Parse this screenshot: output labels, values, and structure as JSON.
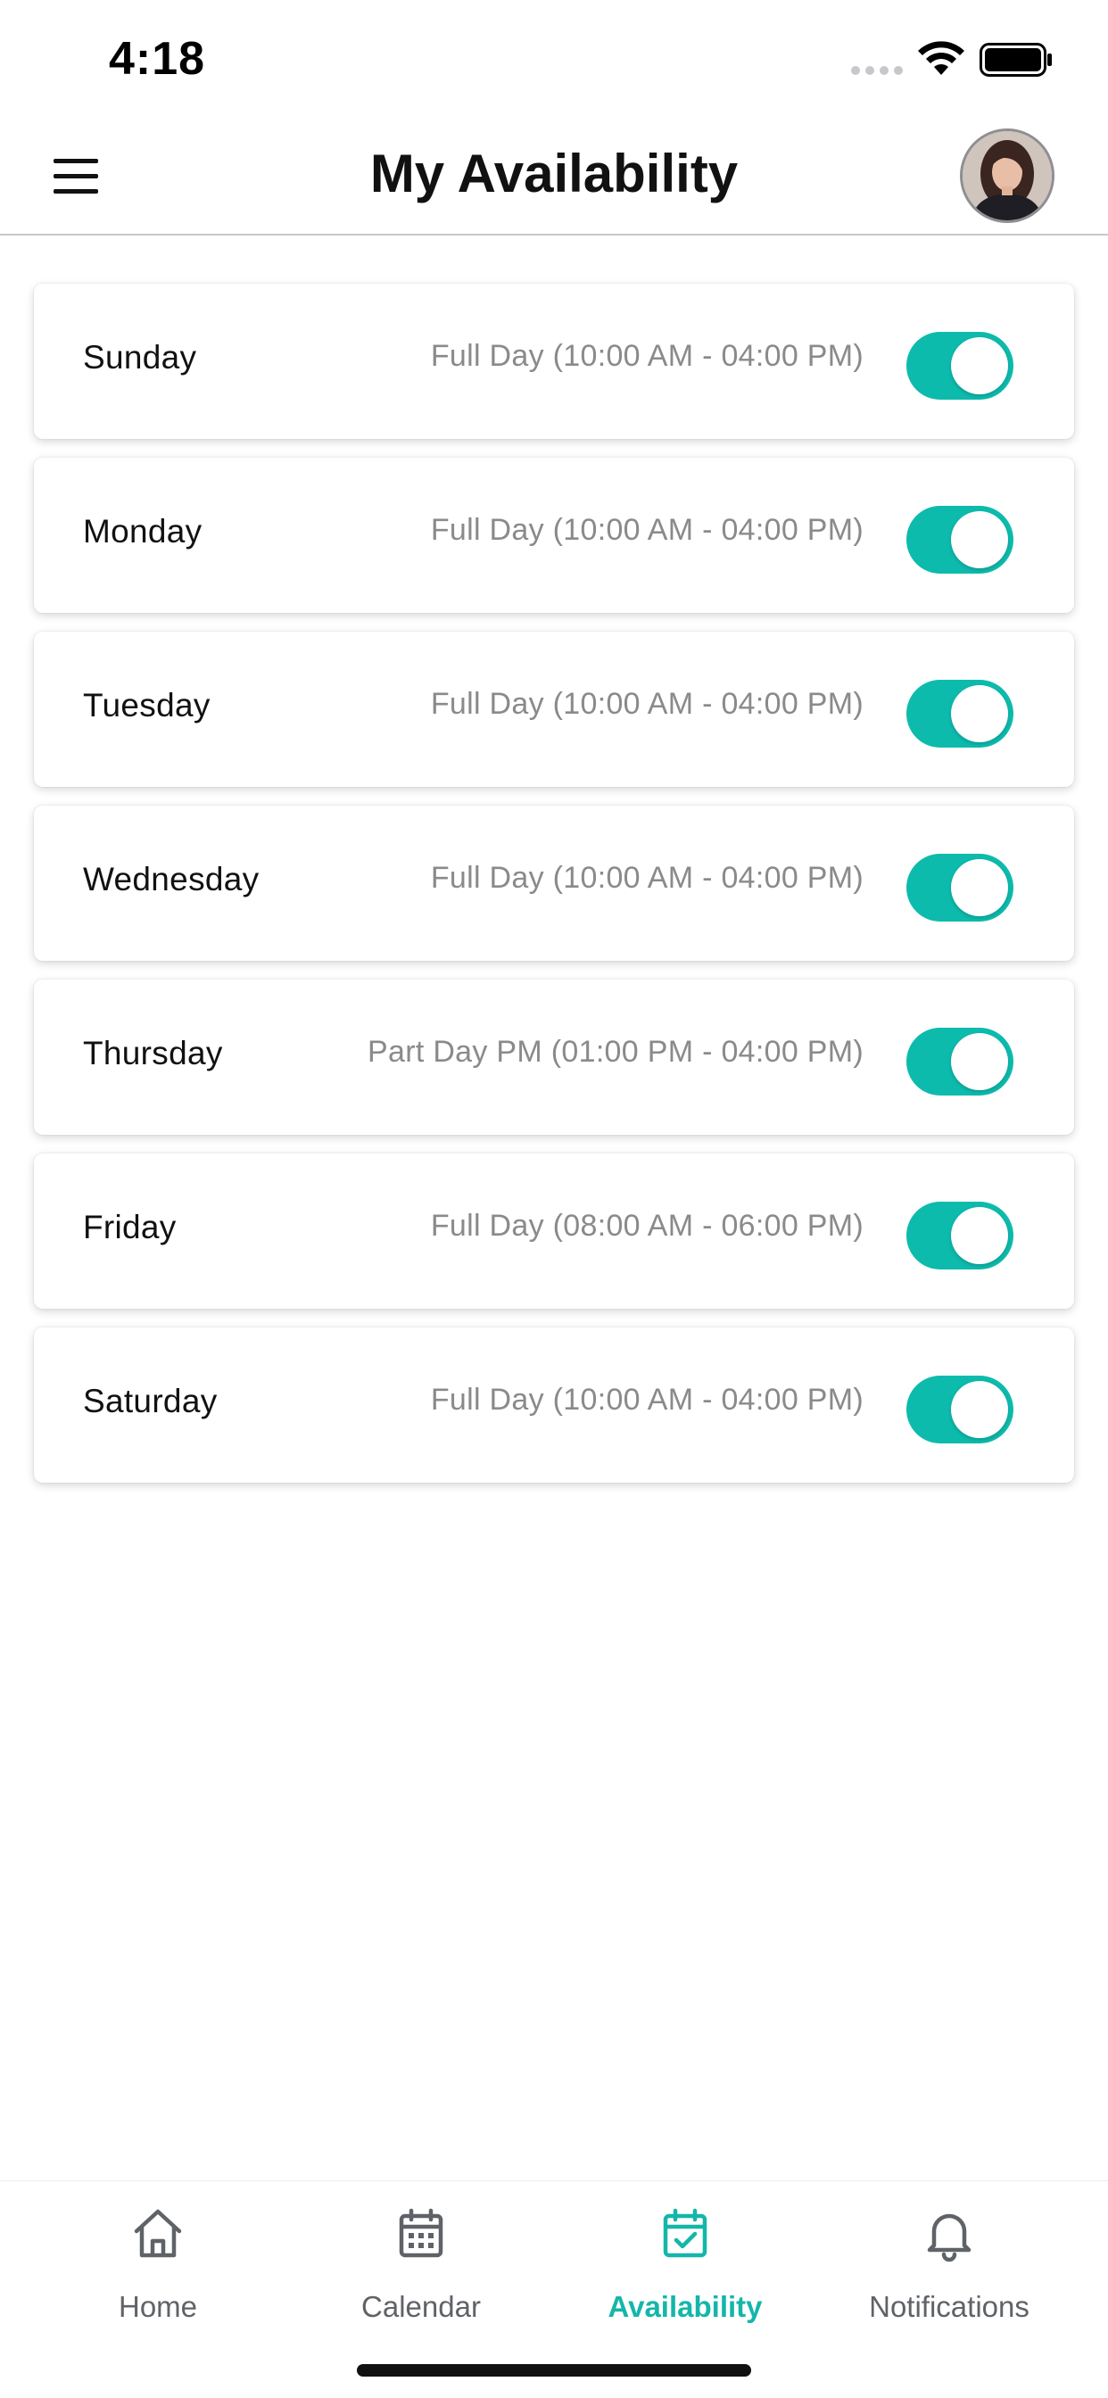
{
  "status_bar": {
    "time": "4:18",
    "icons": [
      "cellular-signal-icon",
      "wifi-icon",
      "battery-icon"
    ]
  },
  "header": {
    "title": "My Availability",
    "menu_icon": "hamburger-menu-icon",
    "avatar": "user-avatar"
  },
  "days": [
    {
      "name": "Sunday",
      "hours": "Full Day (10:00 AM - 04:00 PM)",
      "enabled": true
    },
    {
      "name": "Monday",
      "hours": "Full Day (10:00 AM - 04:00 PM)",
      "enabled": true
    },
    {
      "name": "Tuesday",
      "hours": "Full Day (10:00 AM - 04:00 PM)",
      "enabled": true
    },
    {
      "name": "Wednesday",
      "hours": "Full Day (10:00 AM - 04:00 PM)",
      "enabled": true
    },
    {
      "name": "Thursday",
      "hours": "Part Day PM (01:00 PM - 04:00 PM)",
      "enabled": true
    },
    {
      "name": "Friday",
      "hours": "Full Day (08:00 AM - 06:00 PM)",
      "enabled": true
    },
    {
      "name": "Saturday",
      "hours": "Full Day (10:00 AM - 04:00 PM)",
      "enabled": true
    }
  ],
  "nav": {
    "items": [
      {
        "label": "Home",
        "icon": "home-icon",
        "active": false
      },
      {
        "label": "Calendar",
        "icon": "calendar-icon",
        "active": false
      },
      {
        "label": "Availability",
        "icon": "calendar-check-icon",
        "active": true
      },
      {
        "label": "Notifications",
        "icon": "bell-icon",
        "active": false
      }
    ]
  },
  "colors": {
    "accent": "#0dbbad",
    "active_nav": "#14b6aa",
    "inactive_nav": "#5f6368",
    "secondary_text": "#8a8a8a"
  }
}
